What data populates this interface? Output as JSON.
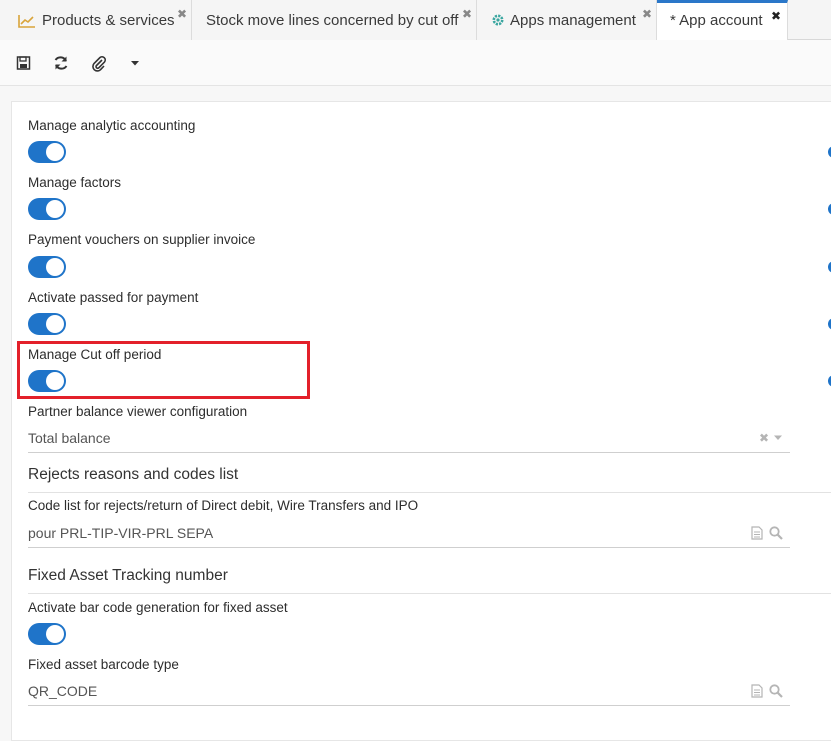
{
  "tabs": [
    {
      "label": "Products & services",
      "icon": "chart-line-icon"
    },
    {
      "label": "Stock move lines concerned by cut off"
    },
    {
      "label": "Apps management",
      "icon": "gear-icon"
    },
    {
      "label": "* App account",
      "active": true
    }
  ],
  "toolbar": {
    "icons": [
      "save-icon",
      "refresh-icon",
      "attachment-icon",
      "caret-down-icon"
    ]
  },
  "fields": {
    "analytic": {
      "label": "Manage analytic accounting",
      "value": true
    },
    "factors": {
      "label": "Manage factors",
      "value": true
    },
    "vouchers": {
      "label": "Payment vouchers on supplier invoice",
      "value": true
    },
    "passed": {
      "label": "Activate passed for payment",
      "value": true
    },
    "cutoff": {
      "label": "Manage Cut off period",
      "value": true
    },
    "partner_balance": {
      "label": "Partner balance viewer configuration",
      "value": "Total balance"
    }
  },
  "rejects": {
    "title": "Rejects reasons and codes list",
    "code_list_label": "Code list for rejects/return of Direct debit, Wire Transfers and IPO",
    "code_list_value": "pour PRL-TIP-VIR-PRL SEPA"
  },
  "fixed_asset": {
    "title": "Fixed Asset Tracking number",
    "barcode_label": "Activate bar code generation for fixed asset",
    "barcode_value": true,
    "barcode_type_label": "Fixed asset barcode type",
    "barcode_type_value": "QR_CODE"
  },
  "colors": {
    "accent": "#1f74c9",
    "highlight": "#e3202a"
  }
}
